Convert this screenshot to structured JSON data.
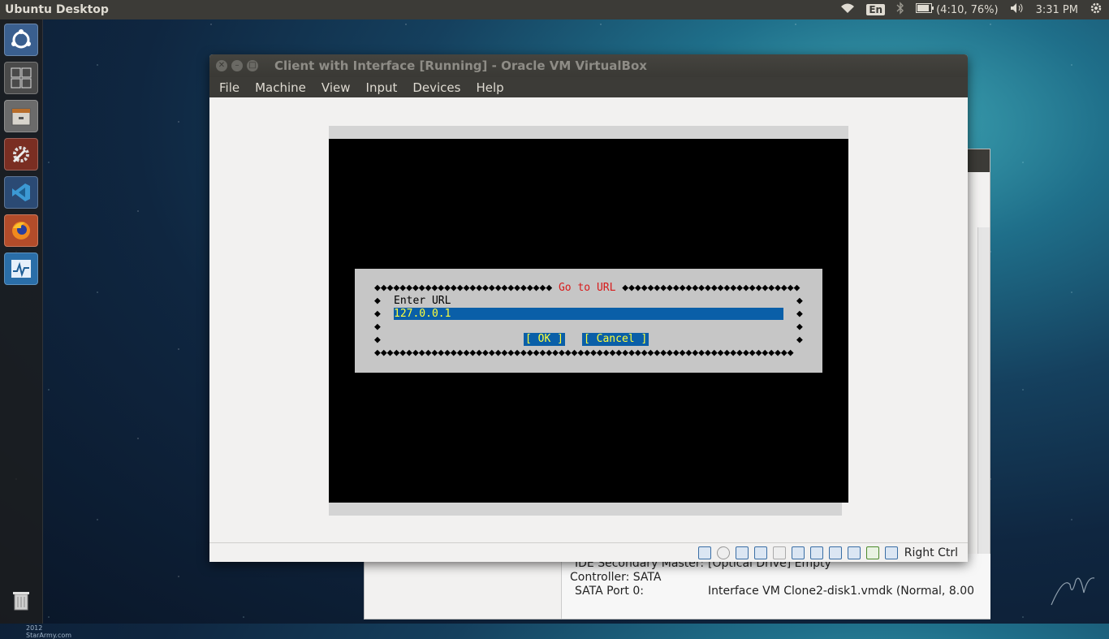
{
  "top_panel": {
    "title": "Ubuntu Desktop",
    "keyboard_lang": "En",
    "battery_text": "(4:10, 76%)",
    "clock": "3:31 PM"
  },
  "launcher": {
    "items": [
      "ubuntu-dash",
      "workspace-switcher",
      "files",
      "system-settings",
      "visual-studio-code",
      "firefox",
      "system-monitor",
      "trash"
    ],
    "credit": "2012 StarArmy.com"
  },
  "vm_window": {
    "title": "Client with Interface [Running] - Oracle VM VirtualBox",
    "menu": [
      "File",
      "Machine",
      "View",
      "Input",
      "Devices",
      "Help"
    ],
    "host_key": "Right Ctrl"
  },
  "dialog": {
    "top_border": "◆◆◆◆◆◆◆◆◆◆◆◆◆◆◆◆◆◆◆◆◆◆◆◆◆◆◆◆",
    "title": "Go to URL",
    "prompt": "Enter URL",
    "url_value": "127.0.0.1",
    "ok_label": "[ OK ]",
    "cancel_label": "[ Cancel ]",
    "bottom_border": "◆◆◆◆◆◆◆◆◆◆◆◆◆◆◆◆◆◆◆◆◆◆◆◆◆◆◆◆◆◆◆◆◆◆◆◆◆◆◆◆◆◆◆◆◆◆◆◆◆◆◆◆◆◆◆◆◆◆◆◆◆◆◆◆◆◆",
    "side_marker": "◆"
  },
  "background_manager": {
    "storage_rows": [
      {
        "label": "IDE Secondary Master:",
        "value": "[Optical Drive] Empty"
      },
      {
        "label": "Controller: SATA",
        "value": ""
      },
      {
        "label": "SATA Port 0:",
        "value": "Interface VM Clone2-disk1.vmdk (Normal, 8.00"
      }
    ]
  }
}
